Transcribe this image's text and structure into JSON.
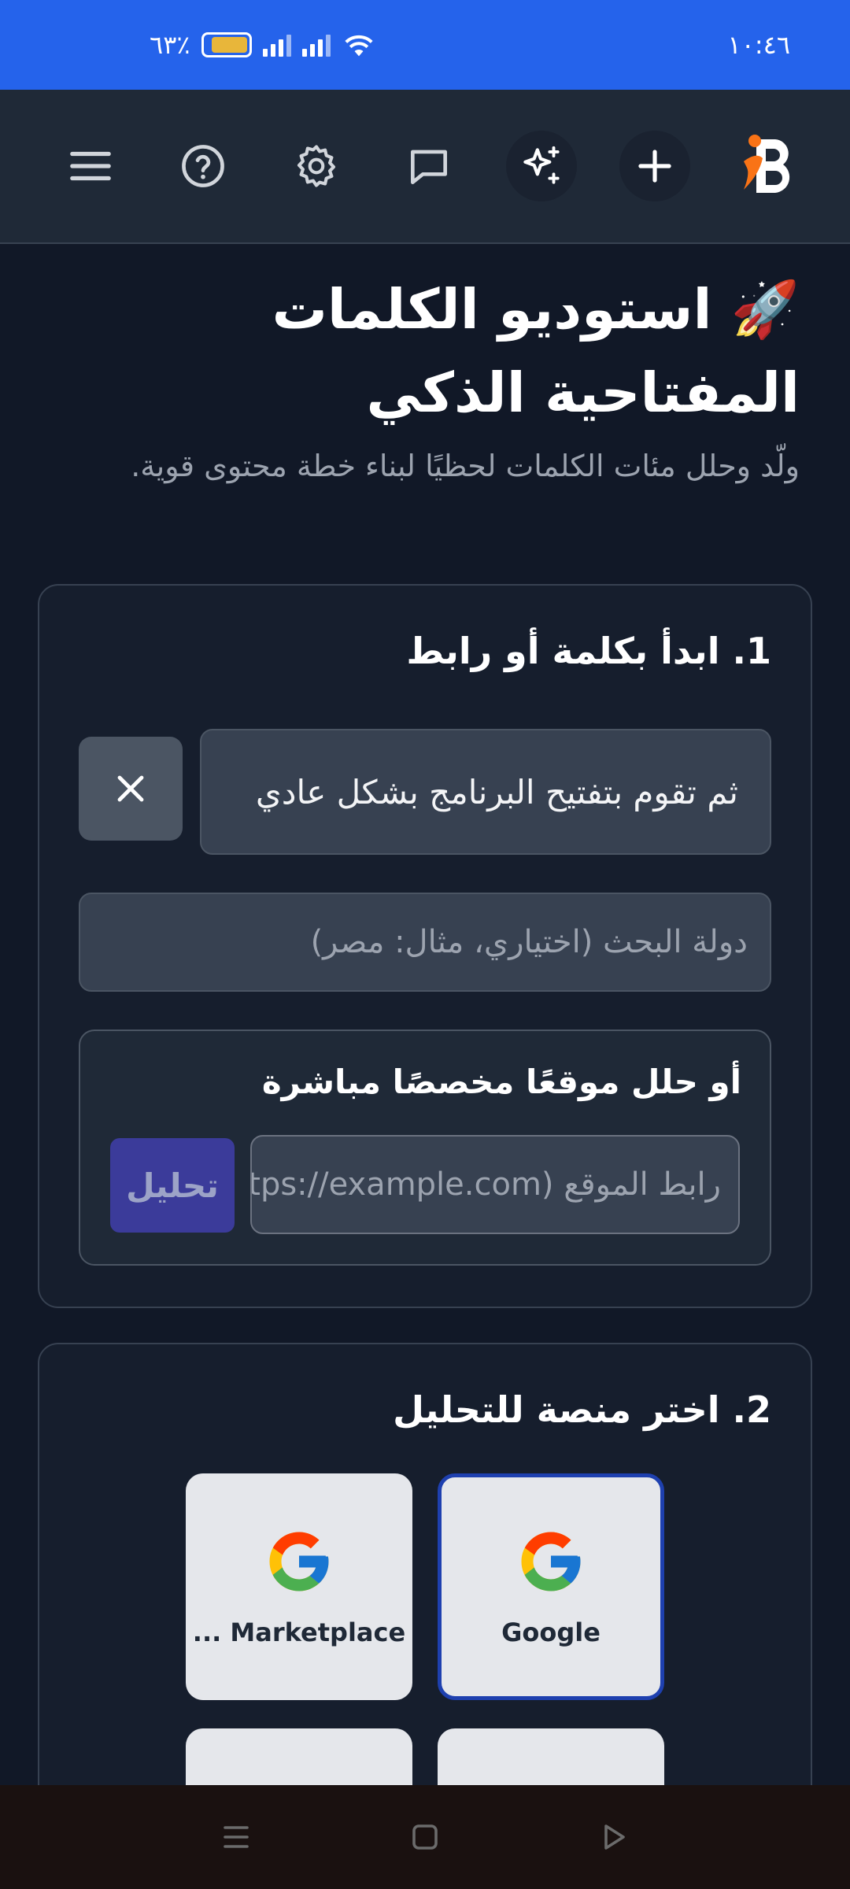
{
  "status": {
    "time": "١٠:٤٦",
    "battery": "٦٣٪"
  },
  "header": {
    "icons": [
      "menu-icon",
      "help-icon",
      "settings-icon",
      "chat-icon",
      "sparkle-icon",
      "plus-icon",
      "logo"
    ]
  },
  "page": {
    "title": "🚀 استوديو الكلمات المفتاحية الذكي",
    "subtitle": "ولّد وحلل مئات الكلمات لحظيًا لبناء خطة محتوى قوية."
  },
  "step1": {
    "title": "1. ابدأ بكلمة أو رابط",
    "keyword_value": "ثم تقوم بتفتيح البرنامج بشكل عادي",
    "country_placeholder": "دولة البحث (اختياري، مثال: مصر)",
    "site_title": "أو حلل موقعًا مخصصًا مباشرة",
    "url_placeholder": "رابط الموقع (https://example.com)",
    "analyze_label": "تحليل"
  },
  "step2": {
    "title": "2. اختر منصة للتحليل",
    "platforms": [
      {
        "label": "Google",
        "icon": "google-icon",
        "selected": true
      },
      {
        "label": "... Marketplace",
        "icon": "google-icon",
        "selected": false
      }
    ]
  },
  "colors": {
    "status_bar": "#2563eb",
    "background": "#111827",
    "header": "#1f2937",
    "accent": "#3b3b9a",
    "logo_orange": "#f97316"
  }
}
